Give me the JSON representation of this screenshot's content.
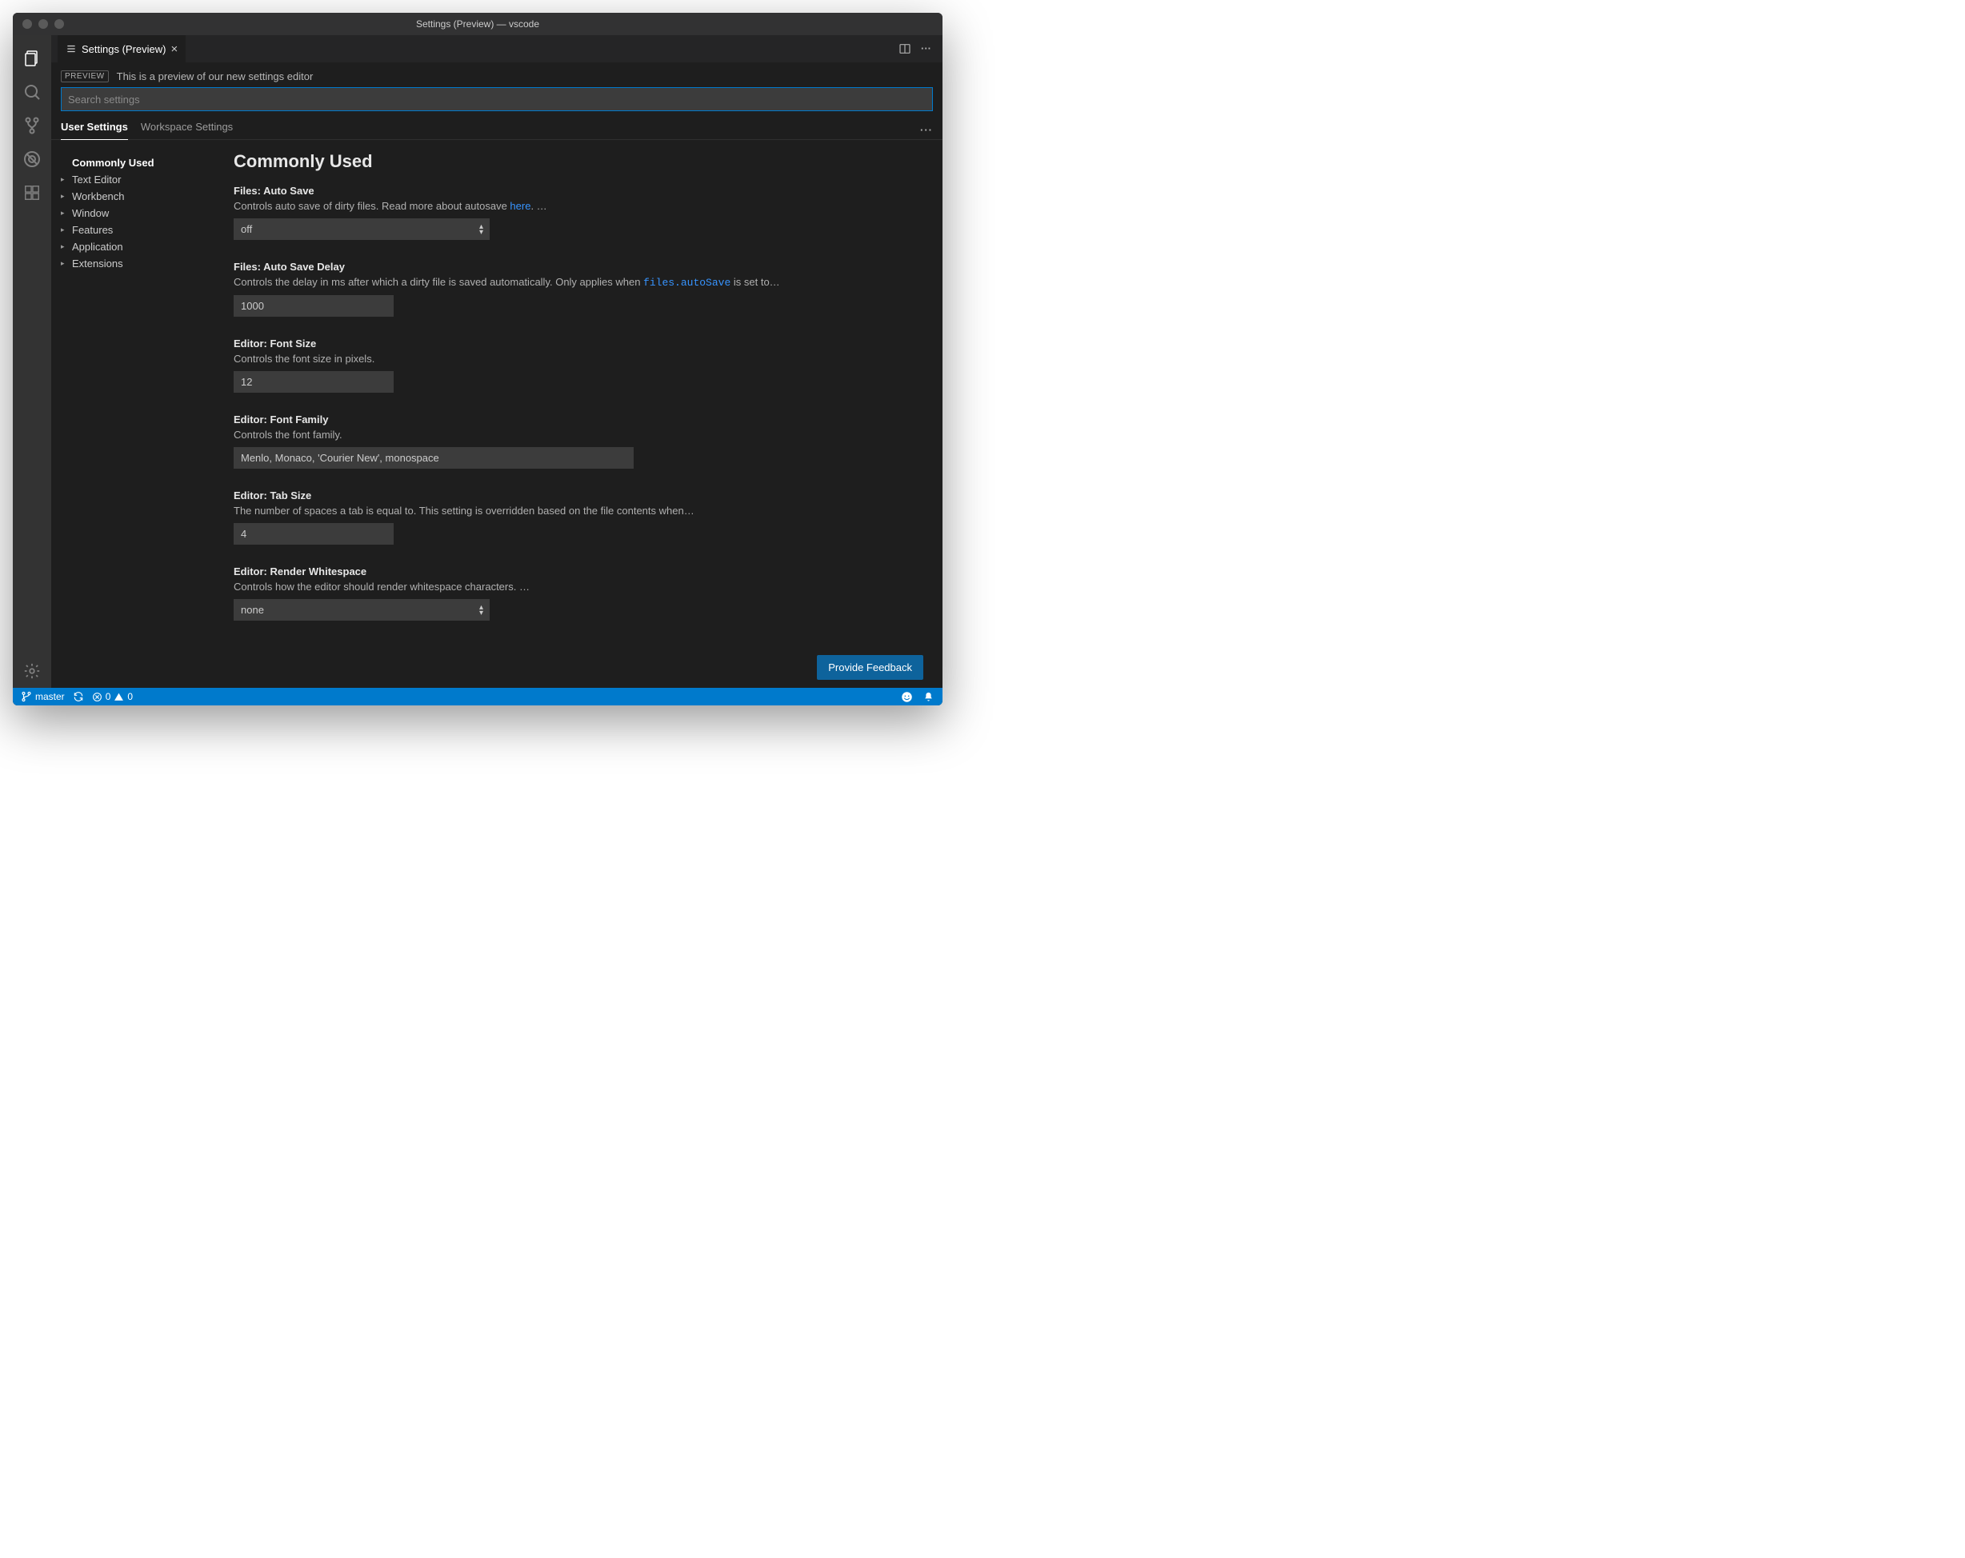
{
  "titlebar": {
    "title": "Settings (Preview) — vscode"
  },
  "tab": {
    "label": "Settings (Preview)"
  },
  "preview": {
    "badge": "PREVIEW",
    "text": "This is a preview of our new settings editor"
  },
  "search": {
    "placeholder": "Search settings"
  },
  "scopeTabs": {
    "user": "User Settings",
    "workspace": "Workspace Settings"
  },
  "tree": {
    "selected": "Commonly Used",
    "items": [
      "Text Editor",
      "Workbench",
      "Window",
      "Features",
      "Application",
      "Extensions"
    ]
  },
  "section": {
    "title": "Commonly Used"
  },
  "settings": [
    {
      "key": "files.autoSave",
      "title": "Files: Auto Save",
      "descPre": "Controls auto save of dirty files. Read more about autosave ",
      "link": "here",
      "descPost": ". …",
      "type": "select",
      "value": "off"
    },
    {
      "key": "files.autoSaveDelay",
      "title": "Files: Auto Save Delay",
      "descPre": "Controls the delay in ms after which a dirty file is saved automatically. Only applies when ",
      "code": "files.autoSave",
      "descPost": " is set to…",
      "type": "narrow",
      "value": "1000"
    },
    {
      "key": "editor.fontSize",
      "title": "Editor: Font Size",
      "desc": "Controls the font size in pixels.",
      "type": "narrow",
      "value": "12"
    },
    {
      "key": "editor.fontFamily",
      "title": "Editor: Font Family",
      "desc": "Controls the font family.",
      "type": "wide",
      "value": "Menlo, Monaco, 'Courier New', monospace"
    },
    {
      "key": "editor.tabSize",
      "title": "Editor: Tab Size",
      "desc": "The number of spaces a tab is equal to. This setting is overridden based on the file contents when…",
      "type": "narrow",
      "value": "4"
    },
    {
      "key": "editor.renderWhitespace",
      "title": "Editor: Render Whitespace",
      "desc": "Controls how the editor should render whitespace characters. …",
      "type": "select",
      "value": "none"
    }
  ],
  "feedback": {
    "label": "Provide Feedback"
  },
  "statusbar": {
    "branch": "master",
    "errors": "0",
    "warnings": "0"
  }
}
